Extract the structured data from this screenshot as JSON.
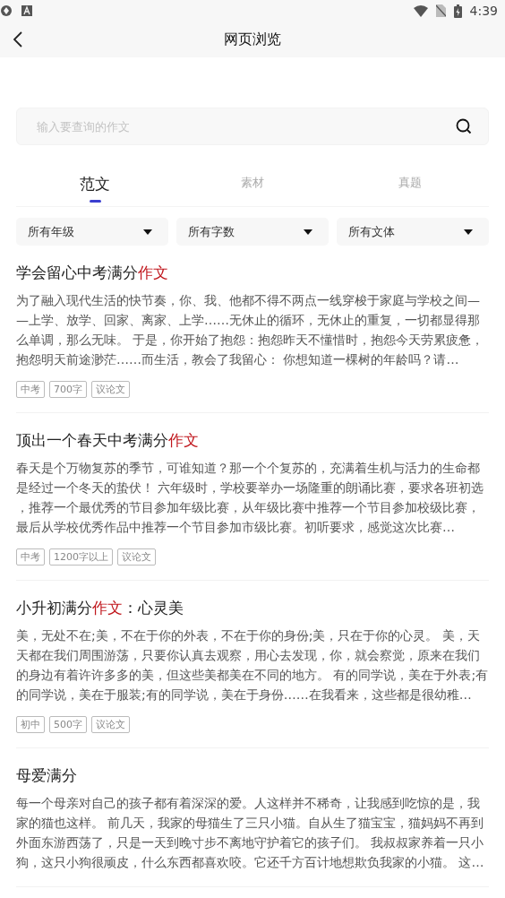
{
  "status_bar": {
    "time": "4:39"
  },
  "header": {
    "title": "网页浏览"
  },
  "search": {
    "placeholder": "输入要查询的作文"
  },
  "tabs": [
    {
      "label": "范文",
      "selected": true
    },
    {
      "label": "素材",
      "selected": false
    },
    {
      "label": "真题",
      "selected": false
    }
  ],
  "filters": [
    {
      "label": "所有年级"
    },
    {
      "label": "所有字数"
    },
    {
      "label": "所有文体"
    }
  ],
  "articles": [
    {
      "title": [
        {
          "text": "学会留心中考满分",
          "highlight": false
        },
        {
          "text": "作文",
          "highlight": true
        }
      ],
      "excerpt": "为了融入现代生活的快节奏，你、我、他都不得不两点一线穿梭于家庭与学校之间——上学、放学、回家、离家、上学……无休止的循环，无休止的重复，一切都显得那么单调，那么无味。 于是，你开始了抱怨：抱怨昨天不懂惜时，抱怨今天劳累疲惫，抱怨明天前途渺茫……而生活，教会了我留心： 你想知道一棵树的年龄吗？请…",
      "tags": [
        "中考",
        "700字",
        "议论文"
      ]
    },
    {
      "title": [
        {
          "text": "顶出一个春天中考满分",
          "highlight": false
        },
        {
          "text": "作文",
          "highlight": true
        }
      ],
      "excerpt": "春天是个万物复苏的季节，可谁知道？那一个个复苏的，充满着生机与活力的生命都是经过一个冬天的蛰伏！ 六年级时，学校要举办一场隆重的朗诵比赛，要求各班初选，推荐一个最优秀的节目参加年级比赛，从年级比赛中推荐一个节目参加校级比赛，最后从学校优秀作品中推荐一个节目参加市级比赛。初听要求，感觉这次比赛…",
      "tags": [
        "中考",
        "1200字以上",
        "议论文"
      ]
    },
    {
      "title": [
        {
          "text": "小升初满分",
          "highlight": false
        },
        {
          "text": "作文",
          "highlight": true
        },
        {
          "text": "：心灵美",
          "highlight": false
        }
      ],
      "excerpt": "美，无处不在;美，不在于你的外表，不在于你的身份;美，只在于你的心灵。 美，天天都在我们周围游荡，只要你认真去观察，用心去发现，你，就会察觉，原来在我们的身边有着许许多多的美，但这些美都美在不同的地方。 有的同学说，美在于外表;有的同学说，美在于服装;有的同学说，美在于身份……在我看来，这些都是很幼稚…",
      "tags": [
        "初中",
        "500字",
        "议论文"
      ]
    },
    {
      "title": [
        {
          "text": "母爱满分",
          "highlight": false
        }
      ],
      "excerpt": "每一个母亲对自己的孩子都有着深深的爱。人这样并不稀奇，让我感到吃惊的是，我家的猫也这样。 前几天，我家的母猫生了三只小猫。自从生了猫宝宝，猫妈妈不再到外面东游西荡了，只是一天到晚寸步不离地守护着它的孩子们。 我叔叔家养着一只小狗，这只小狗很顽皮，什么东西都喜欢咬。它还千方百计地想欺负我家的小猫。 这…"
    }
  ]
}
